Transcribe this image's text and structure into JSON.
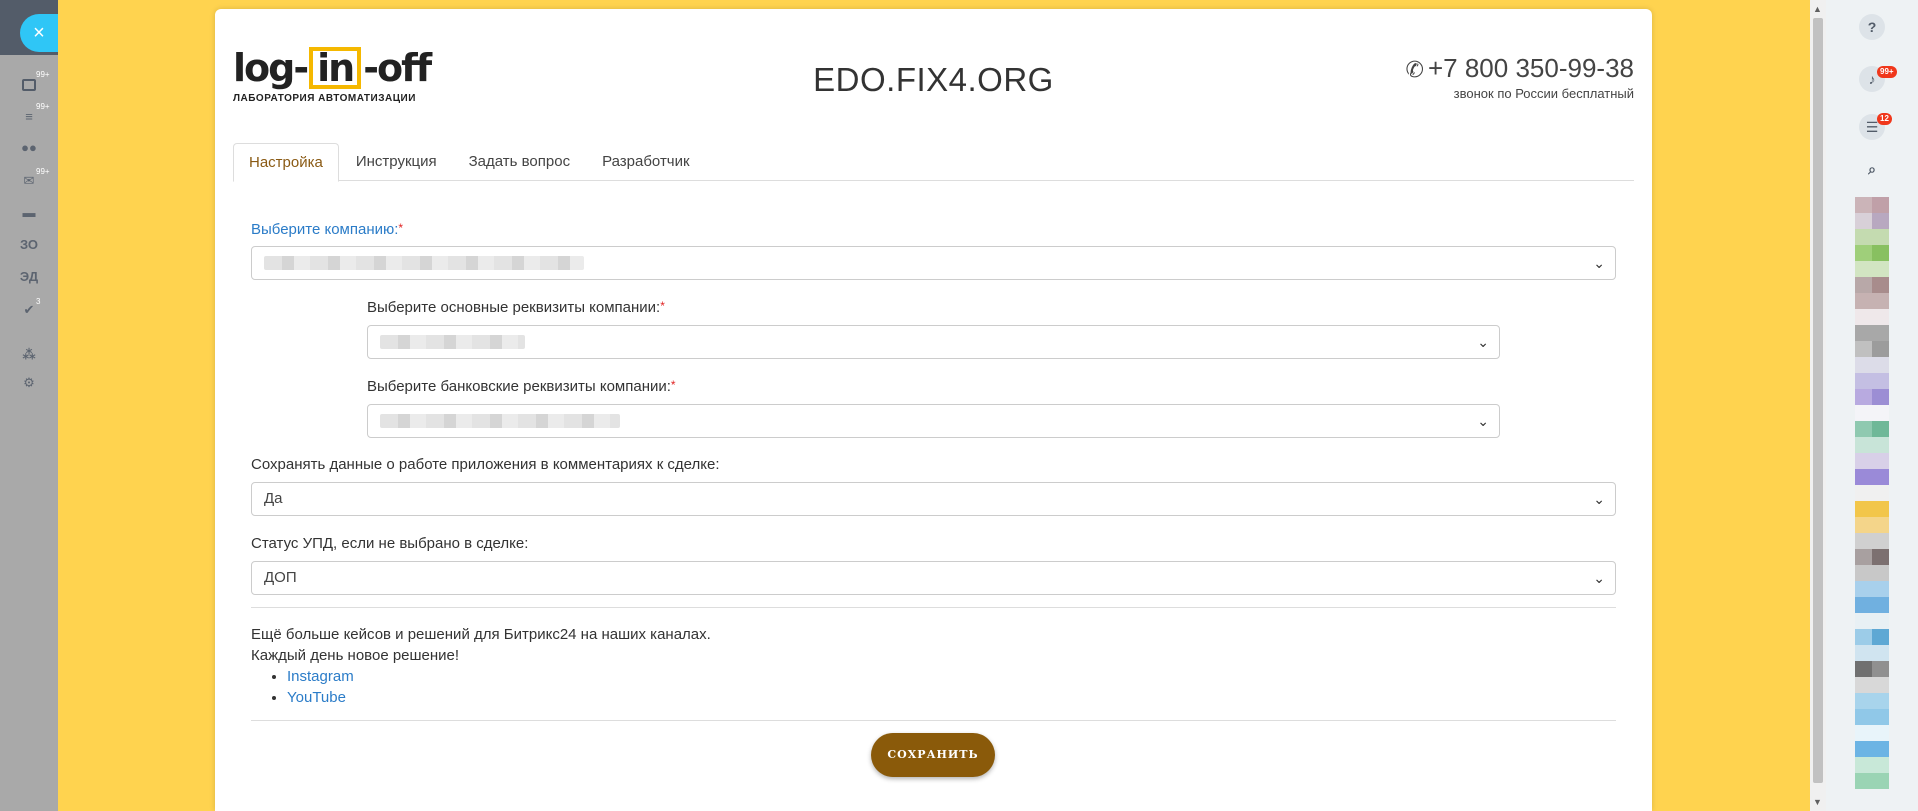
{
  "sidebar": {
    "close_symbol": "×",
    "items": [
      {
        "icon": "tasks-icon",
        "badge": "99+"
      },
      {
        "icon": "filter-icon",
        "badge": "99+"
      },
      {
        "icon": "users-icon",
        "badge": ""
      },
      {
        "icon": "mail-icon",
        "badge": "99+"
      },
      {
        "icon": "inbox-icon",
        "badge": ""
      },
      {
        "label": "ЗО"
      },
      {
        "label": "ЭД"
      },
      {
        "icon": "check-circle-icon",
        "badge": "3"
      },
      {
        "icon": "sitemap-icon"
      },
      {
        "icon": "gear-icon"
      }
    ]
  },
  "header": {
    "logo_text_1": "log",
    "logo_text_box": "in",
    "logo_text_2": "off",
    "logo_subtitle": "ЛАБОРАТОРИЯ АВТОМАТИЗАЦИИ",
    "site_title": "EDO.FIX4.ORG",
    "phone": "+7 800 350-99-38",
    "phone_note": "звонок по России бесплатный"
  },
  "tabs": [
    {
      "label": "Настройка",
      "active": true
    },
    {
      "label": "Инструкция"
    },
    {
      "label": "Задать вопрос"
    },
    {
      "label": "Разработчик"
    }
  ],
  "form": {
    "company_label": "Выберите компанию:",
    "main_requisites_label": "Выберите основные реквизиты компании:",
    "bank_requisites_label": "Выберите банковские реквизиты компании:",
    "required_mark": "*",
    "save_comments_label": "Сохранять данные о работе приложения в комментариях к сделке:",
    "save_comments_value": "Да",
    "upd_status_label": "Статус УПД, если не выбрано в сделке:",
    "upd_status_value": "ДОП"
  },
  "info": {
    "line1": "Ещё больше кейсов и решений для Битрикс24 на наших каналах.",
    "line2": "Каждый день новое решение!",
    "links": [
      "Instagram",
      "YouTube"
    ]
  },
  "save_button": "СОХРАНИТЬ",
  "right_panel": {
    "help_symbol": "?",
    "notifications_badge": "99+",
    "chat_badge": "12"
  },
  "colors": {
    "background": "#ffd34f",
    "accent_brown": "#8a5a0a",
    "link_blue": "#2b7cc8"
  }
}
